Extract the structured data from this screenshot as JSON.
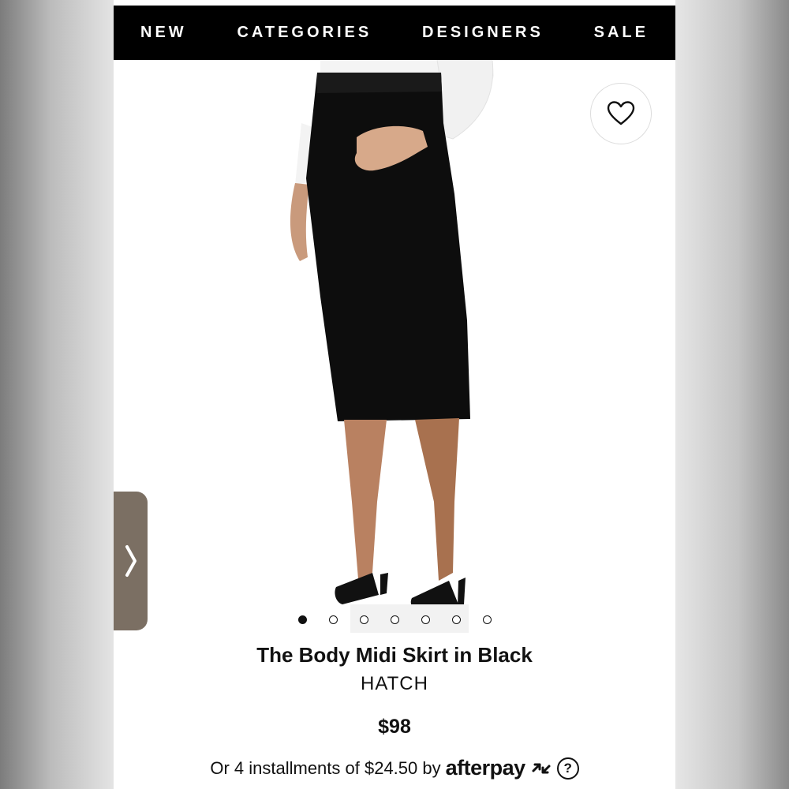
{
  "nav": {
    "items": [
      "NEW",
      "CATEGORIES",
      "DESIGNERS",
      "SALE"
    ]
  },
  "product": {
    "title": "The Body Midi Skirt in Black",
    "brand": "HATCH",
    "price": "$98",
    "image_count": 7,
    "active_image_index": 0
  },
  "payment": {
    "text": "Or 4 installments of $24.50 by",
    "provider": "afterpay",
    "help_symbol": "?"
  },
  "icons": {
    "wishlist": "heart-icon",
    "side_tab": "chevron-right-icon",
    "afterpay_mark": "afterpay-arrows-icon"
  },
  "colors": {
    "navbar": "#000000",
    "nav_text": "#ffffff",
    "side_tab": "#7b6f63"
  }
}
